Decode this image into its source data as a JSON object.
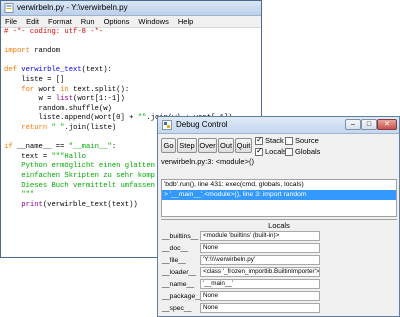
{
  "editor": {
    "title": "verwirbeln.py - Y:\\verwirbeln.py",
    "menu": [
      "File",
      "Edit",
      "Format",
      "Run",
      "Options",
      "Windows",
      "Help"
    ],
    "code": [
      [
        [
          "cm",
          "# -*- coding: utf-8 -*-"
        ]
      ],
      [],
      [
        [
          "kw",
          "import"
        ],
        [
          "df",
          " random"
        ]
      ],
      [],
      [
        [
          "kw",
          "def"
        ],
        [
          "df",
          " "
        ],
        [
          "fn",
          "verwirble_text"
        ],
        [
          "df",
          "(text):"
        ]
      ],
      [
        [
          "df",
          "    liste = []"
        ]
      ],
      [
        [
          "df",
          "    "
        ],
        [
          "kw",
          "for"
        ],
        [
          "df",
          " wort "
        ],
        [
          "kw",
          "in"
        ],
        [
          "df",
          " text.split():"
        ]
      ],
      [
        [
          "df",
          "        w = "
        ],
        [
          "bi",
          "list"
        ],
        [
          "df",
          "(wort[1:-1])"
        ]
      ],
      [
        [
          "df",
          "        random.shuffle(w)"
        ]
      ],
      [
        [
          "df",
          "        liste.append(wort[0] + "
        ],
        [
          "st",
          "\"\""
        ],
        [
          "df",
          ".join(w) + wort[-1])"
        ]
      ],
      [
        [
          "df",
          "    "
        ],
        [
          "kw",
          "return"
        ],
        [
          "df",
          " "
        ],
        [
          "st",
          "\" \""
        ],
        [
          "df",
          ".join(liste)"
        ]
      ],
      [],
      [
        [
          "kw",
          "if"
        ],
        [
          "df",
          " __name__ == "
        ],
        [
          "st",
          "\"__main__\""
        ],
        [
          "df",
          ":"
        ]
      ],
      [
        [
          "df",
          "    text = "
        ],
        [
          "st",
          "\"\"\"Hallo"
        ]
      ],
      [
        [
          "st",
          "    Python ermöglicht einen glatten"
        ]
      ],
      [
        [
          "st",
          "    einfachen Skripten zu sehr komp"
        ]
      ],
      [
        [
          "st",
          "    Dieses Buch vermittelt umfassen"
        ]
      ],
      [
        [
          "st",
          "    \"\"\""
        ]
      ],
      [
        [
          "df",
          "    "
        ],
        [
          "bi",
          "print"
        ],
        [
          "df",
          "(verwirble_text(text))"
        ]
      ]
    ]
  },
  "debug": {
    "title": "Debug Control",
    "buttons": {
      "go": "Go",
      "step": "Step",
      "over": "Over",
      "out": "Out",
      "quit": "Quit"
    },
    "checkboxes": {
      "stack": {
        "label": "Stack",
        "checked": true
      },
      "source": {
        "label": "Source",
        "checked": false
      },
      "locals": {
        "label": "Locals",
        "checked": true
      },
      "globals": {
        "label": "Globals",
        "checked": false
      }
    },
    "status": "verwirbeln.py:3: <module>()",
    "stack": [
      "'bdb'.run(), line 431: exec(cmd, globals, locals)",
      "> '__main__'.<module>(), line 3: import random"
    ],
    "locals_title": "Locals",
    "locals": [
      {
        "name": "__builtins__",
        "value": "<module 'builtins' (built-in)>"
      },
      {
        "name": "__doc__",
        "value": "None"
      },
      {
        "name": "__file__",
        "value": "'Y:\\\\\\\\verwirbeln.py'"
      },
      {
        "name": "__loader__",
        "value": "<class '_frozen_importlib.BuiltinImporter'>"
      },
      {
        "name": "__name__",
        "value": "'__main__'"
      },
      {
        "name": "__package__",
        "value": "None"
      },
      {
        "name": "__spec__",
        "value": "None"
      }
    ]
  }
}
